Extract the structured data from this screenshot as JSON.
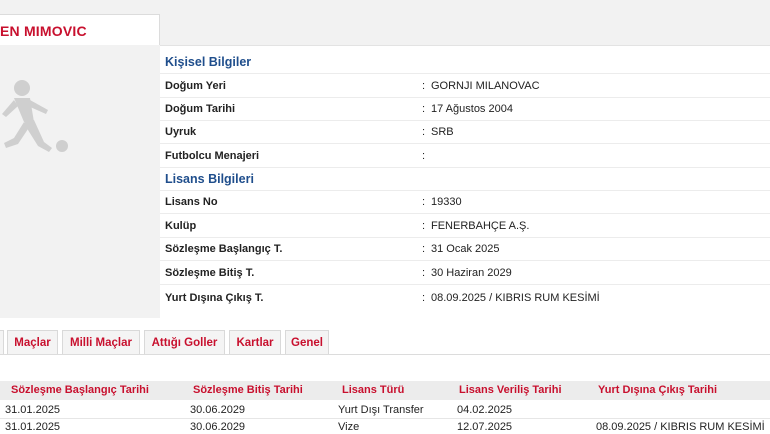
{
  "player": {
    "name": "EN MIMOVIC"
  },
  "personal": {
    "title": "Kişisel Bilgiler",
    "rows": [
      {
        "label": "Doğum Yeri",
        "value": "GORNJI MILANOVAC"
      },
      {
        "label": "Doğum Tarihi",
        "value": "17 Ağustos 2004"
      },
      {
        "label": "Uyruk",
        "value": "SRB"
      },
      {
        "label": "Futbolcu Menajeri",
        "value": ""
      }
    ]
  },
  "license": {
    "title": "Lisans Bilgileri",
    "rows": [
      {
        "label": "Lisans No",
        "value": "19330"
      },
      {
        "label": "Kulüp",
        "value": "FENERBAHÇE A.Ş."
      },
      {
        "label": "Sözleşme Başlangıç T.",
        "value": "31 Ocak 2025"
      },
      {
        "label": "Sözleşme Bitiş T.",
        "value": "30 Haziran 2029"
      },
      {
        "label": "Yurt Dışına Çıkış T.",
        "value": "08.09.2025 / KIBRIS RUM KESİMİ"
      }
    ]
  },
  "colon": ":",
  "tabs": [
    {
      "label": "Maçlar"
    },
    {
      "label": "Milli Maçlar"
    },
    {
      "label": "Attığı Goller"
    },
    {
      "label": "Kartlar"
    },
    {
      "label": "Genel"
    }
  ],
  "contracts_table": {
    "headers": [
      "Sözleşme Başlangıç Tarihi",
      "Sözleşme Bitiş Tarihi",
      "Lisans Türü",
      "Lisans Veriliş Tarihi",
      "Yurt Dışına Çıkış Tarihi"
    ],
    "rows": [
      [
        "31.01.2025",
        "30.06.2029",
        "Yurt Dışı Transfer",
        "04.02.2025",
        ""
      ],
      [
        "31.01.2025",
        "30.06.2029",
        "Vize",
        "12.07.2025",
        "08.09.2025 / KIBRIS RUM KESİMİ"
      ]
    ]
  },
  "colors": {
    "accent_red": "#c8102e",
    "section_blue": "#1f4e8c"
  }
}
